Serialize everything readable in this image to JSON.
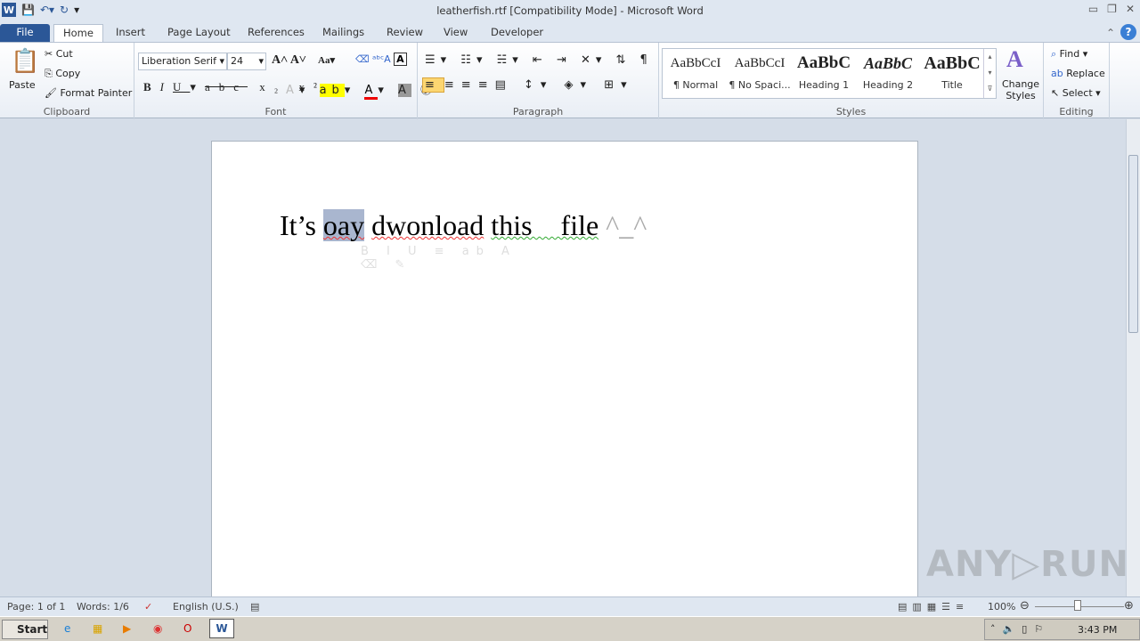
{
  "window": {
    "title": "leatherfish.rtf [Compatibility Mode]  -  Microsoft Word"
  },
  "tabs": [
    "File",
    "Home",
    "Insert",
    "Page Layout",
    "References",
    "Mailings",
    "Review",
    "View",
    "Developer"
  ],
  "clipboard": {
    "paste": "Paste",
    "cut": "Cut",
    "copy": "Copy",
    "format_painter": "Format Painter",
    "label": "Clipboard"
  },
  "font": {
    "name": "Liberation Serif",
    "size": "24",
    "label": "Font"
  },
  "paragraph": {
    "label": "Paragraph"
  },
  "styles": {
    "items": [
      {
        "preview": "AaBbCcI",
        "name": "¶ Normal"
      },
      {
        "preview": "AaBbCcI",
        "name": "¶ No Spaci..."
      },
      {
        "preview": "AaBbC",
        "name": "Heading 1"
      },
      {
        "preview": "AaBbC",
        "name": "Heading 2"
      },
      {
        "preview": "AaBbC",
        "name": "Title"
      }
    ],
    "change": "Change Styles",
    "label": "Styles"
  },
  "editing": {
    "find": "Find",
    "replace": "Replace",
    "select": "Select",
    "label": "Editing"
  },
  "document": {
    "w1": "It’s ",
    "w2": "oay",
    "w3": " ",
    "w4": "dwonload",
    "w5": " ",
    "w6": "this    file",
    "w7": " ^_^"
  },
  "status": {
    "page": "Page: 1 of 1",
    "words": "Words: 1/6",
    "language": "English (U.S.)",
    "zoom": "100%"
  },
  "taskbar": {
    "start": "Start",
    "time": "3:43 PM"
  },
  "watermark": "ANY RUN"
}
